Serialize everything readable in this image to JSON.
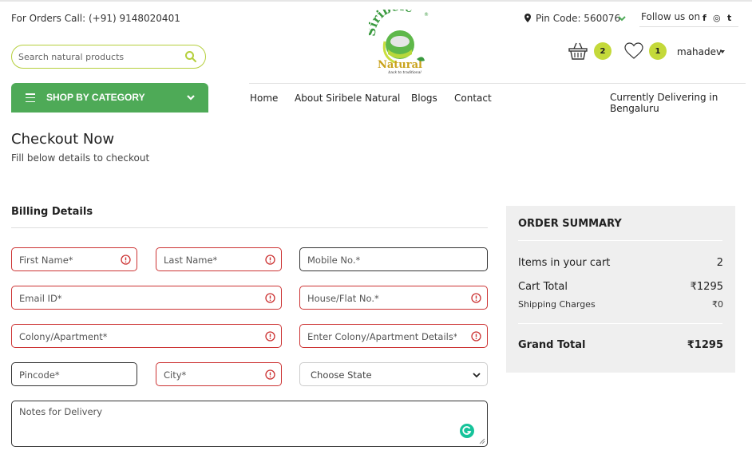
{
  "header": {
    "orders_call": "For Orders Call: (+91) 9148020401",
    "search_placeholder": "Search natural products",
    "category_button": "SHOP BY CATEGORY",
    "logo": {
      "brand_top": "Siribele",
      "brand_bottom": "Natural",
      "tagline": "back to traditional",
      "registered": "®"
    },
    "pin_code": "Pin Code: 560076",
    "follow_us": "Follow us on",
    "social": [
      "f",
      "◎",
      "t"
    ],
    "cart_count": "2",
    "wishlist_count": "1",
    "user_name": "mahadev"
  },
  "nav": {
    "items": [
      "Home",
      "About Siribele Natural",
      "Blogs",
      "Contact"
    ],
    "delivering": "Currently Delivering in Bengaluru"
  },
  "page": {
    "title": "Checkout Now",
    "subtitle": "Fill below details to checkout"
  },
  "billing": {
    "title": "Billing Details",
    "fields": {
      "first_name": "First Name*",
      "last_name": "Last Name*",
      "mobile": "Mobile No.*",
      "email": "Email ID*",
      "house": "House/Flat No.*",
      "colony": "Colony/Apartment*",
      "colony_details": "Enter Colony/Apartment Details*",
      "pincode": "Pincode*",
      "city": "City*",
      "state": "Choose State",
      "notes": "Notes for Delivery"
    }
  },
  "summary": {
    "title": "ORDER SUMMARY",
    "items_label": "Items in your cart",
    "items_value": "2",
    "cart_total_label": "Cart Total",
    "cart_total_value": "₹1295",
    "shipping_label": "Shipping Charges",
    "shipping_value": "₹0",
    "grand_total_label": "Grand Total",
    "grand_total_value": "₹1295"
  },
  "colors": {
    "brand_green": "#4eaa57",
    "accent_lime": "#c4d93a",
    "error_red": "#cc3333",
    "summary_bg": "#efefef"
  },
  "icons": [
    "search-icon",
    "menu-icon",
    "chevron-down-icon",
    "location-pin-icon",
    "facebook-icon",
    "instagram-icon",
    "twitter-icon",
    "basket-icon",
    "heart-icon",
    "caret-down-icon",
    "error-icon",
    "grammarly-icon"
  ]
}
